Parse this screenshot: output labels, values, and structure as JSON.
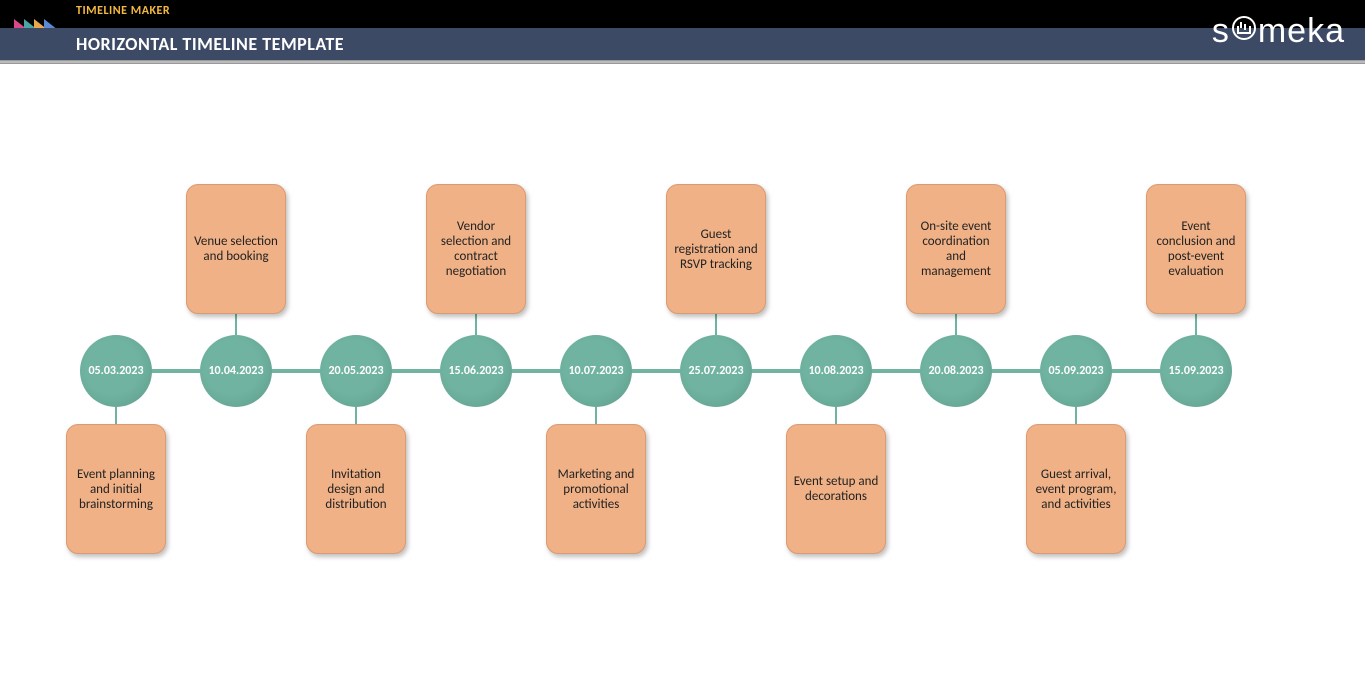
{
  "header": {
    "small_title": "TIMELINE MAKER",
    "main_title": "HORIZONTAL TIMELINE TEMPLATE",
    "brand_prefix": "s",
    "brand_mid": "meka"
  },
  "timeline": {
    "node_color": "#6fb3a0",
    "card_color": "#f0b186",
    "items": [
      {
        "date": "05.03.2023",
        "label": "Event planning and initial brainstorming",
        "position": "down"
      },
      {
        "date": "10.04.2023",
        "label": "Venue selection and booking",
        "position": "up"
      },
      {
        "date": "20.05.2023",
        "label": "Invitation design and distribution",
        "position": "down"
      },
      {
        "date": "15.06.2023",
        "label": "Vendor selection and contract negotiation",
        "position": "up"
      },
      {
        "date": "10.07.2023",
        "label": "Marketing and promotional activities",
        "position": "down"
      },
      {
        "date": "25.07.2023",
        "label": "Guest registration and RSVP tracking",
        "position": "up"
      },
      {
        "date": "10.08.2023",
        "label": "Event setup and decorations",
        "position": "down"
      },
      {
        "date": "20.08.2023",
        "label": "On-site event coordination and management",
        "position": "up"
      },
      {
        "date": "05.09.2023",
        "label": "Guest arrival, event program, and activities",
        "position": "down"
      },
      {
        "date": "15.09.2023",
        "label": "Event conclusion and post-event evaluation",
        "position": "up"
      }
    ]
  }
}
